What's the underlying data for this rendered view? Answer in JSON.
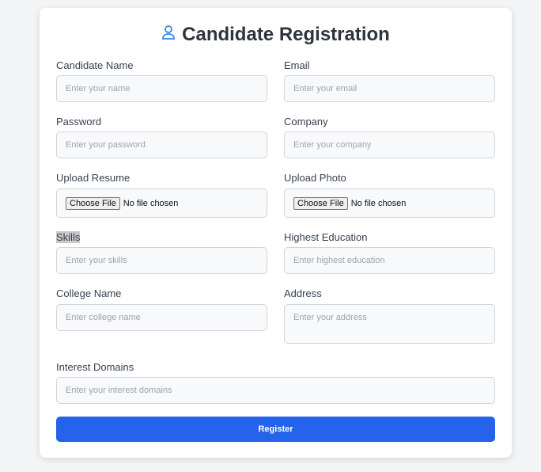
{
  "title": "Candidate Registration",
  "fields": {
    "name": {
      "label": "Candidate Name",
      "placeholder": "Enter your name"
    },
    "email": {
      "label": "Email",
      "placeholder": "Enter your email"
    },
    "password": {
      "label": "Password",
      "placeholder": "Enter your password"
    },
    "company": {
      "label": "Company",
      "placeholder": "Enter your company"
    },
    "resume": {
      "label": "Upload Resume",
      "button": "Choose File",
      "status": "No file chosen"
    },
    "photo": {
      "label": "Upload Photo",
      "button": "Choose File",
      "status": "No file chosen"
    },
    "skills": {
      "label": "Skills",
      "placeholder": "Enter your skills"
    },
    "education": {
      "label": "Highest Education",
      "placeholder": "Enter highest education"
    },
    "college": {
      "label": "College Name",
      "placeholder": "Enter college name"
    },
    "address": {
      "label": "Address",
      "placeholder": "Enter your address"
    },
    "interests": {
      "label": "Interest Domains",
      "placeholder": "Enter your interest domains"
    }
  },
  "register_label": "Register",
  "colors": {
    "accent": "#2563eb"
  }
}
